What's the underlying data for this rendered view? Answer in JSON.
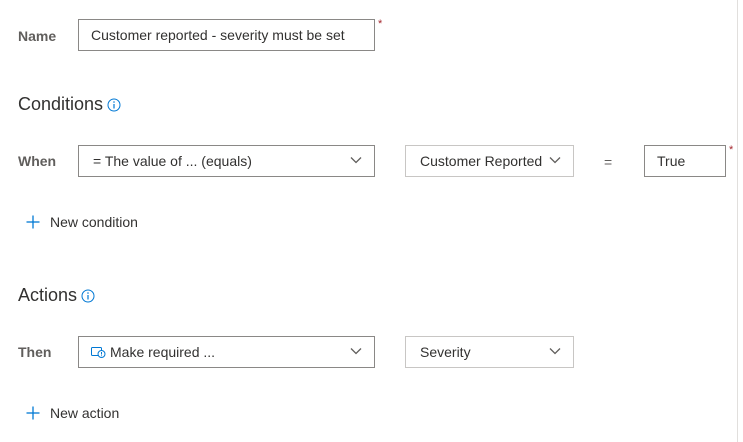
{
  "name_row": {
    "label": "Name",
    "value": "Customer reported - severity must be set",
    "required_mark": "*"
  },
  "conditions": {
    "heading": "Conditions",
    "when_label": "When",
    "operator_select": "= The value of ... (equals)",
    "field_select": "Customer Reported",
    "equals_sign": "=",
    "value": "True",
    "required_mark": "*",
    "new_condition": "New condition"
  },
  "actions": {
    "heading": "Actions",
    "then_label": "Then",
    "action_select": "Make required ...",
    "field_select": "Severity",
    "new_action": "New action"
  },
  "colors": {
    "accent": "#0078d4",
    "required": "#a4262c",
    "border": "#8a8886"
  }
}
